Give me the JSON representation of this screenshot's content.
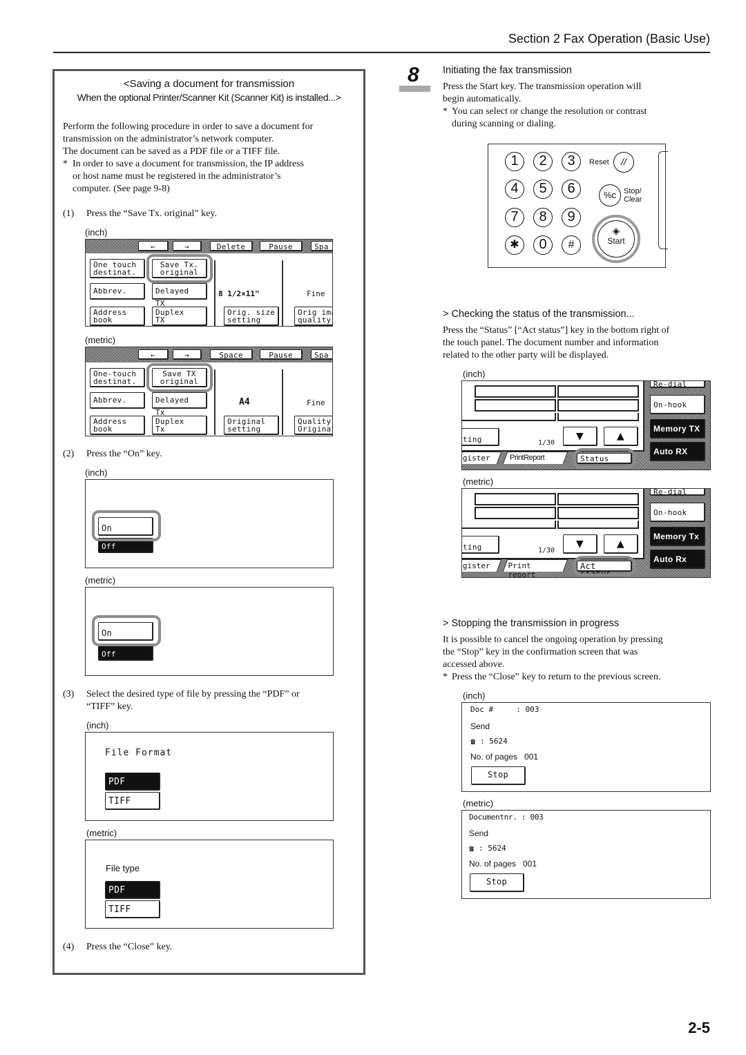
{
  "header": {
    "section_title": "Section 2  Fax Operation (Basic Use)",
    "page_number": "2-5"
  },
  "left_panel": {
    "title_line1": "<Saving a document for transmission",
    "title_line2": "When the optional Printer/Scanner Kit (Scanner Kit) is installed...>",
    "intro_lines": [
      "Perform the following procedure in order to save a document for",
      "transmission on the administrator’s network computer.",
      "The document can be saved as a PDF file or a TIFF file."
    ],
    "note_marker": "*",
    "note_lines": [
      "In order to save a document for transmission, the IP address",
      "or host name must be registered in the administrator’s",
      "computer. (See page 9-8)"
    ],
    "steps": [
      {
        "num": "(1)",
        "text": "Press the “Save Tx. original” key."
      },
      {
        "num": "(2)",
        "text": "Press the “On” key."
      },
      {
        "num": "(3)",
        "text_line1": "Select the desired type of file by pressing the “PDF” or",
        "text_line2": "“TIFF” key."
      },
      {
        "num": "(4)",
        "text": "Press the “Close” key."
      }
    ],
    "unit_labels": {
      "inch": "(inch)",
      "metric": "(metric)"
    },
    "fax_screen_inch": {
      "top_bar": [
        "←",
        "→",
        "Delete",
        "Pause",
        "Spa"
      ],
      "row1": [
        "One touch\ndestinat.",
        "Save Tx.\noriginal"
      ],
      "row2": [
        "Abbrev.",
        "Delayed TX"
      ],
      "row3": [
        "Address\nbook",
        "Duplex\nTX",
        "Orig. size\nsetting",
        "Orig imag\nquality"
      ],
      "paper_size": "8 1/2×11\"",
      "resolution": "Fine"
    },
    "fax_screen_metric": {
      "top_bar": [
        "←",
        "→",
        "Space",
        "Pause",
        "Spa"
      ],
      "row1": [
        "One-touch\ndestinat.",
        "Save TX\noriginal"
      ],
      "row2": [
        "Abbrev.",
        "Delayed Tx"
      ],
      "row3": [
        "Address\nbook",
        "Duplex\nTx",
        "Original\nsetting",
        "Quality\nOriginal"
      ],
      "paper_size": "A4",
      "resolution": "Fine"
    },
    "on_off_screen": {
      "on": "On",
      "off": "Off"
    },
    "file_format_inch": {
      "label": "File Format",
      "options": [
        "PDF",
        "TIFF"
      ],
      "selected": "PDF"
    },
    "file_format_metric": {
      "label": "File type",
      "options": [
        "PDF",
        "TIFF"
      ],
      "selected": "PDF"
    }
  },
  "right_column": {
    "step_number": "8",
    "step_heading": "Initiating the fax transmission",
    "step_lines": [
      "Press the Start key. The transmission operation will",
      "begin automatically."
    ],
    "step_note": [
      "You can select or change the resolution or contrast",
      "during scanning or dialing."
    ],
    "note_marker": "*",
    "keypad": {
      "keys": [
        "1",
        "2",
        "3",
        "4",
        "5",
        "6",
        "7",
        "8",
        "9",
        "✱",
        "0",
        "#"
      ],
      "reset_label": "Reset",
      "stop_clear_label_1": "Stop/",
      "stop_clear_label_2": "Clear",
      "stop_clear_glyph": "%c",
      "start_label": "Start",
      "reset_glyph": "//",
      "start_glyph": "◈"
    },
    "checking": {
      "heading": "> Checking the status of the transmission...",
      "lines": [
        "Press the “Status” [“Act status”] key in the bottom right of",
        "the touch panel. The document number and information",
        "related to the other party will be displayed."
      ],
      "inch_screen": {
        "right_buttons": [
          "Re-dial",
          "On-hook",
          "Memory TX",
          "Auto RX"
        ],
        "left_btn": "ting",
        "page_counter": "1/30",
        "tabs": [
          "gister",
          "PrintReport",
          "Status"
        ]
      },
      "metric_screen": {
        "right_buttons": [
          "Re-dial",
          "On-hook",
          "Memory Tx",
          "Auto Rx"
        ],
        "left_btn": "ting",
        "page_counter": "1/30",
        "tabs": [
          "gister",
          "Print report",
          "Act status"
        ]
      }
    },
    "stopping": {
      "heading": "> Stopping the transmission in progress",
      "lines": [
        "It is possible to cancel the ongoing operation by pressing",
        "the “Stop” key in the confirmation screen that was",
        "accessed above."
      ],
      "note": "Press the “Close” key to return to the previous screen.",
      "inch_screen": {
        "doc_line": "Doc #     : 003",
        "send": "Send",
        "phone": ": 5624",
        "pages": "No. of pages   001",
        "stop": "Stop"
      },
      "metric_screen": {
        "doc_line": "Documentnr. : 003",
        "send": "Send",
        "phone": ": 5624",
        "pages": "No. of pages   001",
        "stop": "Stop"
      }
    }
  }
}
